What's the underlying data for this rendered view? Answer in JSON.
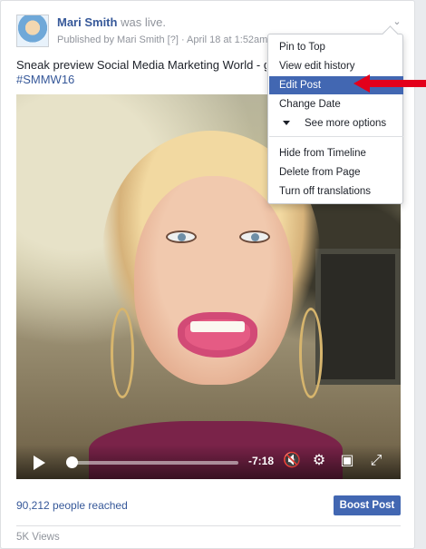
{
  "post": {
    "author": "Mari Smith",
    "action": "was live.",
    "meta": "Published by Mari Smith [?] · April 18 at 1:52am ·",
    "caption": "Sneak preview Social Media Marketing World - go",
    "hashtag": "#SMMW16"
  },
  "menu": {
    "items": [
      {
        "label": "Pin to Top"
      },
      {
        "label": "View edit history"
      },
      {
        "label": "Edit Post",
        "highlighted": true
      },
      {
        "label": "Change Date"
      },
      {
        "label": "See more options",
        "icon": "triangle-down-icon"
      },
      {
        "label": "Hide from Timeline"
      },
      {
        "label": "Delete from Page"
      },
      {
        "label": "Turn off translations"
      }
    ]
  },
  "video": {
    "time_remaining": "-7:18",
    "progress": 0.03
  },
  "footer": {
    "reach": "90,212 people reached",
    "boost_label": "Boost Post",
    "views": "5K Views"
  },
  "colors": {
    "accent": "#4267b2",
    "link": "#365899",
    "annotation_arrow": "#e3001b"
  }
}
